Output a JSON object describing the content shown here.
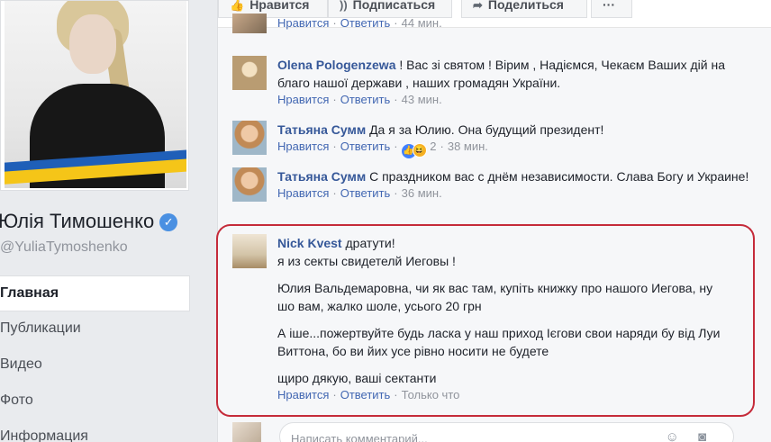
{
  "page": {
    "name": "Юлія Тимошенко",
    "name_visible": "Юлія Тимошенко",
    "handle": "@YuliaTymoshenko"
  },
  "nav": {
    "items": [
      {
        "label": "Главная",
        "active": true
      },
      {
        "label": "Публикации"
      },
      {
        "label": "Видео"
      },
      {
        "label": "Фото"
      },
      {
        "label": "Информация"
      }
    ]
  },
  "actions": {
    "like": "Нравится",
    "follow": "Подписаться",
    "share": "Поделиться",
    "more": "···"
  },
  "comment_meta": {
    "like": "Нравится",
    "reply": "Ответить"
  },
  "comments": [
    {
      "time": "44 мин."
    },
    {
      "author": "Olena Pologenzewa",
      "text": "! Вас зі святом ! Вірим , Надіємся, Чекаєм Ваших дій на благо нашої держави , наших громадян України.",
      "time": "43 мин."
    },
    {
      "author": "Татьяна Сумм",
      "text": "Да я за Юлию. Она будущий президент!",
      "reactions_count": "2",
      "time": "38 мин."
    },
    {
      "author": "Татьяна Сумм",
      "text": "С праздником вас с днём независимости. Слава Богу и Украине!",
      "time": "36 мин."
    },
    {
      "author": "Nick Kvest",
      "lines": [
        "дратути!",
        "я из секты свидетелй Иеговы !",
        "Юлия Вальдемаровна, чи як вас там, купіть книжку про нашого Иегова, ну шо вам, жалко шоле, усього 20 грн",
        "А іше...пожертвуйте будь ласка у наш приход Ієгови свои наряди бу від Луи Виттона, бо ви йих усе рівно носити не будете",
        "щиро дякую, ваші сектанти"
      ],
      "time": "Только что"
    }
  ],
  "composer": {
    "placeholder": "Написать комментарий..."
  },
  "colors": {
    "link": "#4267b2",
    "author": "#365899",
    "highlight": "#c52b3a",
    "flag_blue": "#1f5fb8",
    "flag_yellow": "#f5c518"
  }
}
